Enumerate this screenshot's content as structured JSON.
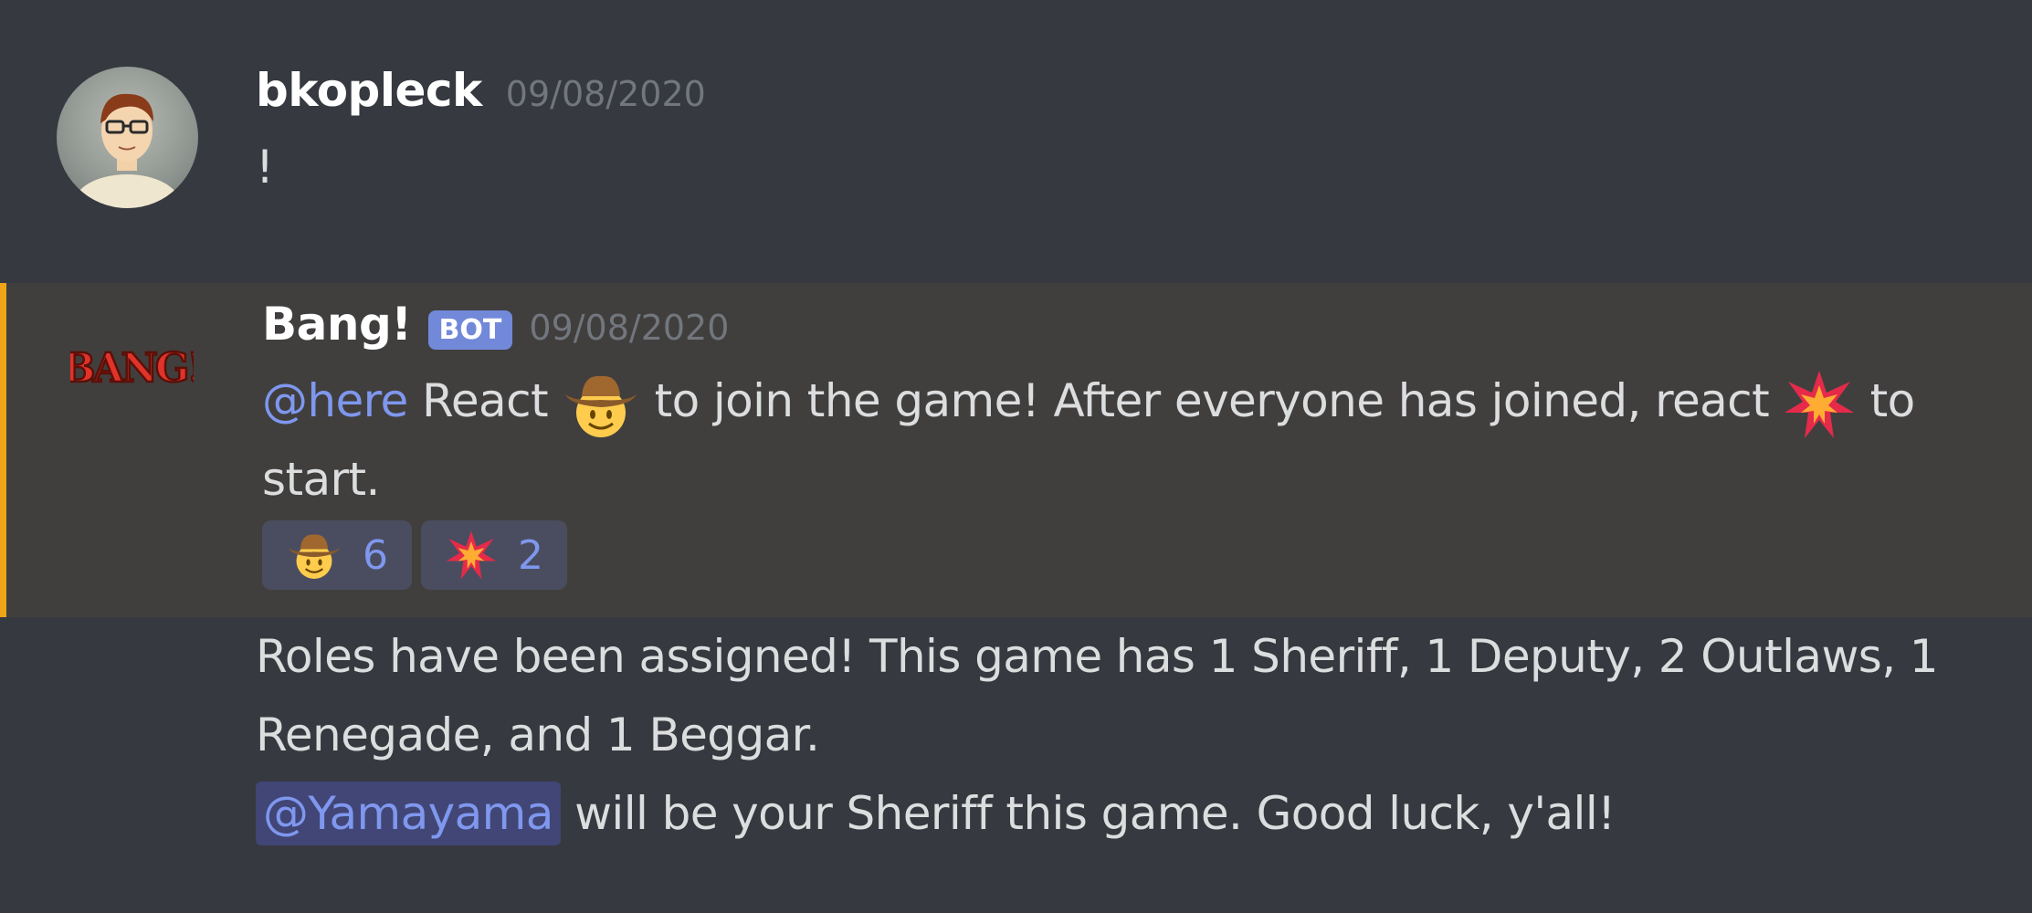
{
  "messages": [
    {
      "author": "bkopleck",
      "timestamp": "09/08/2020",
      "text": "!"
    },
    {
      "author": "Bang!",
      "badge": "BOT",
      "timestamp": "09/08/2020",
      "logo_text": "BANG!",
      "mention": "@here",
      "text_part1": "React",
      "text_part2": "to join the game! After everyone has joined, react",
      "text_part3": "to",
      "text_line2": "start.",
      "reactions": [
        {
          "emoji": "cowboy-hat-face-icon",
          "count": "6"
        },
        {
          "emoji": "collision-icon",
          "count": "2"
        }
      ],
      "accent_color": "#f0a418"
    },
    {
      "line1": "Roles have been assigned! This game has 1 Sheriff, 1 Deputy, 2 Outlaws, 1",
      "line2": "Renegade, and 1 Beggar.",
      "mention": "@Yamayama",
      "line3_rest": "will be your Sheriff this game. Good luck, y'all!"
    }
  ],
  "colors": {
    "background": "#36393f",
    "highlight": "#413f3e",
    "mention": "#7f97ee",
    "bot_badge": "#7289da"
  }
}
